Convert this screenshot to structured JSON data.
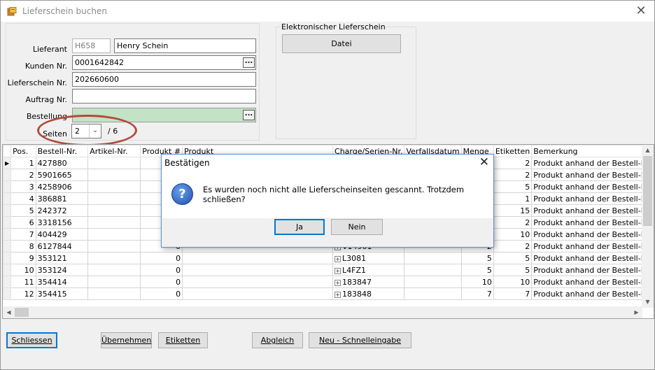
{
  "window": {
    "title": "Lieferschein buchen"
  },
  "form": {
    "lieferant_label": "Lieferant",
    "lieferant_code": "H658",
    "lieferant_name": "Henry Schein",
    "kunden_label": "Kunden Nr.",
    "kunden_value": "0001642842",
    "lieferschein_label": "Lieferschein Nr.",
    "lieferschein_value": "202660600",
    "auftrag_label": "Auftrag Nr.",
    "auftrag_value": "",
    "bestellung_label": "Bestellung",
    "bestellung_value": "",
    "seiten_label": "Seiten",
    "seiten_value": "2",
    "seiten_total": "/ 6",
    "browse_label": "..."
  },
  "electronic": {
    "group_label": "Elektronischer Lieferschein",
    "datei_button": "Datei"
  },
  "grid": {
    "columns": [
      "Pos.",
      "Bestell-Nr.",
      "Artikel-Nr.",
      "Produkt #",
      "Produkt",
      "Charge/Serien-Nr.",
      "Verfallsdatum",
      "Menge",
      "Etiketten",
      "Bemerkung"
    ],
    "rows": [
      {
        "pos": "1",
        "bestell": "427880",
        "artikel": "",
        "produkt_nr": "",
        "produkt": "",
        "charge": "",
        "verfall": "",
        "menge": "2",
        "etiketten": "2",
        "bemerkung": "Produkt anhand der Bestell-Nr."
      },
      {
        "pos": "2",
        "bestell": "5901665",
        "artikel": "",
        "produkt_nr": "",
        "produkt": "",
        "charge": "",
        "verfall": "",
        "menge": "2",
        "etiketten": "2",
        "bemerkung": "Produkt anhand der Bestell-Nr."
      },
      {
        "pos": "3",
        "bestell": "4258906",
        "artikel": "",
        "produkt_nr": "",
        "produkt": "",
        "charge": "",
        "verfall": "",
        "menge": "5",
        "etiketten": "5",
        "bemerkung": "Produkt anhand der Bestell-Nr."
      },
      {
        "pos": "4",
        "bestell": "386881",
        "artikel": "",
        "produkt_nr": "",
        "produkt": "",
        "charge": "",
        "verfall": "",
        "menge": "1",
        "etiketten": "1",
        "bemerkung": "Produkt anhand der Bestell-Nr."
      },
      {
        "pos": "5",
        "bestell": "242372",
        "artikel": "",
        "produkt_nr": "",
        "produkt": "",
        "charge": "",
        "verfall": "",
        "menge": "15",
        "etiketten": "15",
        "bemerkung": "Produkt anhand der Bestell-Nr."
      },
      {
        "pos": "6",
        "bestell": "3318156",
        "artikel": "",
        "produkt_nr": "",
        "produkt": "",
        "charge": "",
        "verfall": "",
        "menge": "2",
        "etiketten": "2",
        "bemerkung": "Produkt anhand der Bestell-Nr."
      },
      {
        "pos": "7",
        "bestell": "404429",
        "artikel": "",
        "produkt_nr": "",
        "produkt": "",
        "charge": "",
        "verfall": "",
        "menge": "10",
        "etiketten": "10",
        "bemerkung": "Produkt anhand der Bestell-Nr."
      },
      {
        "pos": "8",
        "bestell": "6127844",
        "artikel": "",
        "produkt_nr": "0",
        "produkt": "",
        "charge": "V14901",
        "verfall": "",
        "menge": "2",
        "etiketten": "2",
        "bemerkung": "Produkt anhand der Bestell-Nr."
      },
      {
        "pos": "9",
        "bestell": "353121",
        "artikel": "",
        "produkt_nr": "0",
        "produkt": "",
        "charge": "L3081",
        "verfall": "",
        "menge": "5",
        "etiketten": "5",
        "bemerkung": "Produkt anhand der Bestell-Nr."
      },
      {
        "pos": "10",
        "bestell": "353124",
        "artikel": "",
        "produkt_nr": "0",
        "produkt": "",
        "charge": "L4FZ1",
        "verfall": "",
        "menge": "5",
        "etiketten": "5",
        "bemerkung": "Produkt anhand der Bestell-Nr."
      },
      {
        "pos": "11",
        "bestell": "354414",
        "artikel": "",
        "produkt_nr": "0",
        "produkt": "",
        "charge": "183847",
        "verfall": "",
        "menge": "10",
        "etiketten": "10",
        "bemerkung": "Produkt anhand der Bestell-Nr."
      },
      {
        "pos": "12",
        "bestell": "354415",
        "artikel": "",
        "produkt_nr": "0",
        "produkt": "",
        "charge": "183848",
        "verfall": "",
        "menge": "7",
        "etiketten": "7",
        "bemerkung": "Produkt anhand der Bestell-Nr."
      }
    ]
  },
  "buttons": {
    "schliessen": "Schliessen",
    "uebernehmen": "Übernehmen",
    "etiketten": "Etiketten",
    "abgleich": "Abgleich",
    "neu": "Neu - Schnelleingabe"
  },
  "dialog": {
    "title": "Bestätigen",
    "message": "Es wurden noch nicht alle Lieferscheinseiten gescannt. Trotzdem schließen?",
    "yes": "Ja",
    "no": "Nein",
    "icon": "question-icon"
  },
  "colors": {
    "highlight_ellipse": "#b34a3c",
    "bestellung_field": "#c4e2c5",
    "focus_border": "#0078d7"
  }
}
